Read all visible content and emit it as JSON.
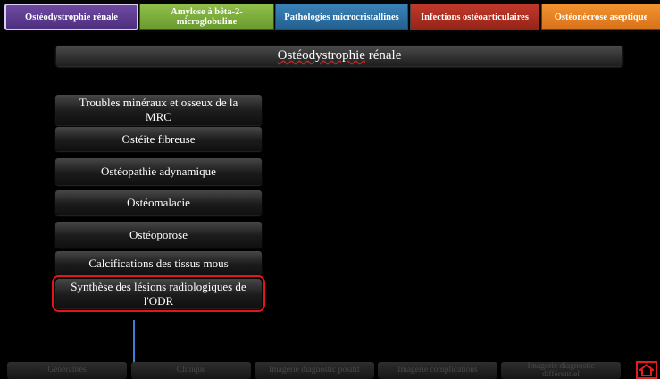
{
  "tabs": [
    {
      "label": "Ostéodystrophie rénale"
    },
    {
      "label": "Amylose à bêta-2-microglobuline"
    },
    {
      "label": "Pathologies microcristallines"
    },
    {
      "label": "Infections ostéoarticulaires"
    },
    {
      "label": "Ostéonécrose aseptique"
    }
  ],
  "title": {
    "main": "Ostéodystrophie",
    "rest": " rénale"
  },
  "menu": [
    {
      "label": "Troubles minéraux et osseux de la MRC"
    },
    {
      "label": "Ostéite fibreuse"
    },
    {
      "label": "Ostéopathie adynamique"
    },
    {
      "label": "Ostéomalacie"
    },
    {
      "label": "Ostéoporose"
    },
    {
      "label": "Calcifications des tissus mous"
    },
    {
      "label": "Synthèse des lésions radiologiques de l'ODR"
    }
  ],
  "bottom_nav": [
    {
      "label": "Généralités"
    },
    {
      "label": "Clinique"
    },
    {
      "label": "Imagerie diagnostic positif"
    },
    {
      "label": "Imagerie complications"
    },
    {
      "label": "Imagerie diagnostic différentiel"
    }
  ],
  "colors": {
    "selected_outline": "#e8141c",
    "tab_purple": "#5b3a8f",
    "tab_green": "#7aab3a",
    "tab_blue": "#2d72a6",
    "tab_red": "#b03022",
    "tab_orange": "#ef8a2a"
  }
}
